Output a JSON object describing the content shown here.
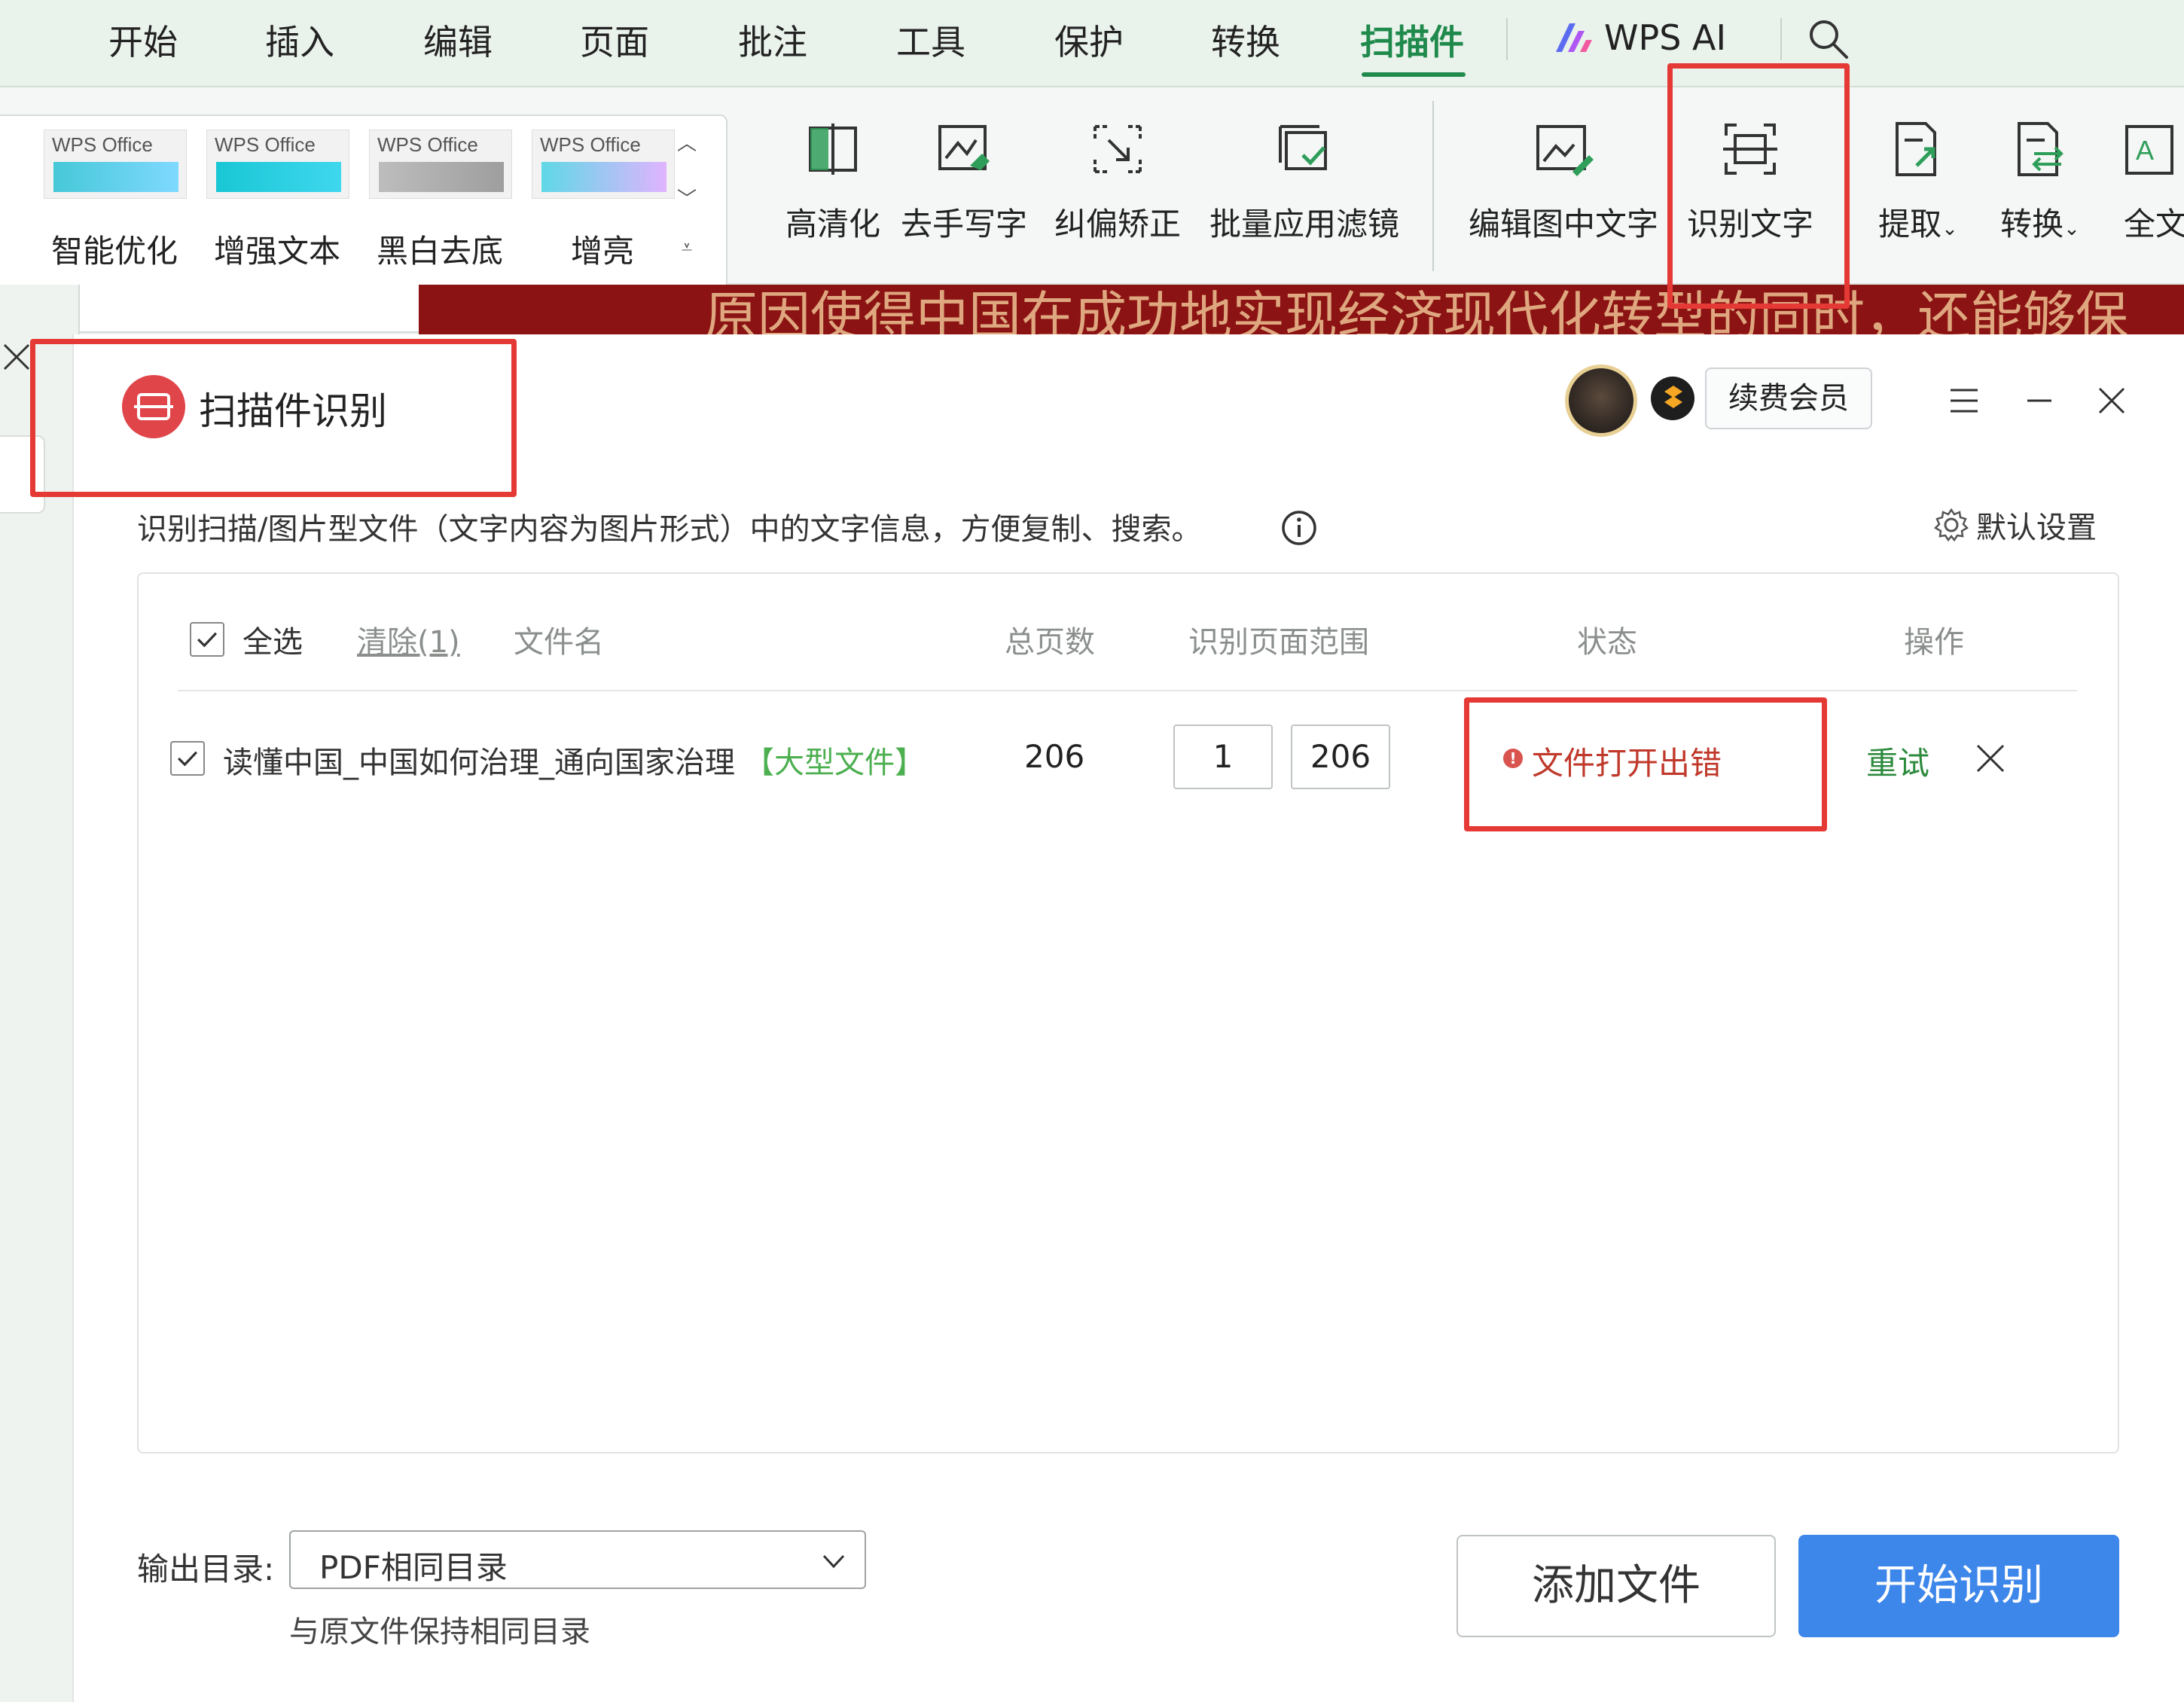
{
  "menubar": {
    "tabs": [
      "开始",
      "插入",
      "编辑",
      "页面",
      "批注",
      "工具",
      "保护",
      "转换",
      "扫描件"
    ],
    "active_tab": "扫描件",
    "wps_ai_label": "WPS AI"
  },
  "ribbon": {
    "gallery": {
      "brand": "WPS Office",
      "items": [
        "智能优化",
        "增强文本",
        "黑白去底",
        "增亮"
      ]
    },
    "buttons": {
      "hd": "高清化",
      "remove_handwriting": "去手写字",
      "deskew": "纠偏矫正",
      "batch_filter": "批量应用滤镜",
      "edit_image_text": "编辑图中文字",
      "recognize_text": "识别文字",
      "extract": "提取",
      "convert": "转换",
      "fulltext": "全文"
    }
  },
  "document": {
    "banner_text": "原因使得中国在成功地实现经济现代化转型的同时，还能够保"
  },
  "dialog": {
    "title": "扫描件识别",
    "renew_label": "续费会员",
    "description": "识别扫描/图片型文件（文字内容为图片形式）中的文字信息，方便复制、搜索。",
    "settings_label": "默认设置",
    "table": {
      "select_all": "全选",
      "clear": "清除(1)",
      "columns": {
        "file_name": "文件名",
        "total_pages": "总页数",
        "page_range": "识别页面范围",
        "status": "状态",
        "actions": "操作"
      },
      "rows": [
        {
          "checked": true,
          "file_name": "读懂中国_中国如何治理_通向国家治理",
          "tag": "【大型文件】",
          "total_pages": "206",
          "range_from": "1",
          "range_to": "206",
          "status": "文件打开出错",
          "retry": "重试"
        }
      ]
    },
    "footer": {
      "output_label": "输出目录:",
      "output_value": "PDF相同目录",
      "output_hint": "与原文件保持相同目录",
      "add_files": "添加文件",
      "start": "开始识别"
    }
  },
  "colors": {
    "accent_green": "#1f8a4c",
    "error_red": "#c0392b",
    "primary_blue": "#3d86ea",
    "highlight_red": "#e53935"
  }
}
